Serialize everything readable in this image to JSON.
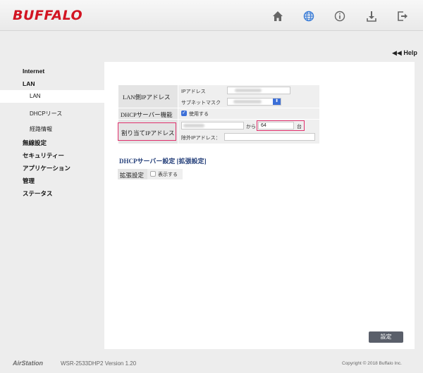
{
  "header": {
    "logo": "BUFFALO",
    "icons": [
      "home-icon",
      "globe-icon",
      "info-icon",
      "download-icon",
      "logout-icon"
    ],
    "active_icon_color": "#3c7ed8"
  },
  "help": {
    "label": "◀◀ Help"
  },
  "sidebar": {
    "items": [
      {
        "label": "Internet"
      },
      {
        "label": "LAN"
      },
      {
        "label": "LAN",
        "active": true
      },
      {
        "label": "DHCPリース"
      },
      {
        "label": "経路情報"
      },
      {
        "label": "無線設定"
      },
      {
        "label": "セキュリティー"
      },
      {
        "label": "アプリケーション"
      },
      {
        "label": "管理"
      },
      {
        "label": "ステータス"
      }
    ]
  },
  "lan_settings": {
    "lan_ip_label": "LAN側IPアドレス",
    "ip_address_label": "IPアドレス",
    "subnet_mask_label": "サブネットマスク",
    "dhcp_label": "DHCPサーバー機能",
    "dhcp_use_label": "使用する",
    "dhcp_checked": true,
    "assign_label": "割り当てIPアドレス",
    "from_label": "から",
    "count_value": "64",
    "count_unit": "台",
    "exclude_label": "除外IPアドレス：",
    "highlight_color": "#e0306c"
  },
  "dhcp_advanced": {
    "title": "DHCPサーバー設定 [拡張設定]",
    "ext_label": "拡張設定",
    "show_label": "表示する",
    "show_checked": false
  },
  "buttons": {
    "save": "設定"
  },
  "footer": {
    "brand": "AirStation",
    "model": "WSR-2533DHP2  Version 1.20",
    "copyright": "Copyright © 2018 Buffalo Inc."
  },
  "colors": {
    "brand": "#d21422",
    "accent": "#3c6fd8",
    "title_blue": "#243f7a"
  }
}
